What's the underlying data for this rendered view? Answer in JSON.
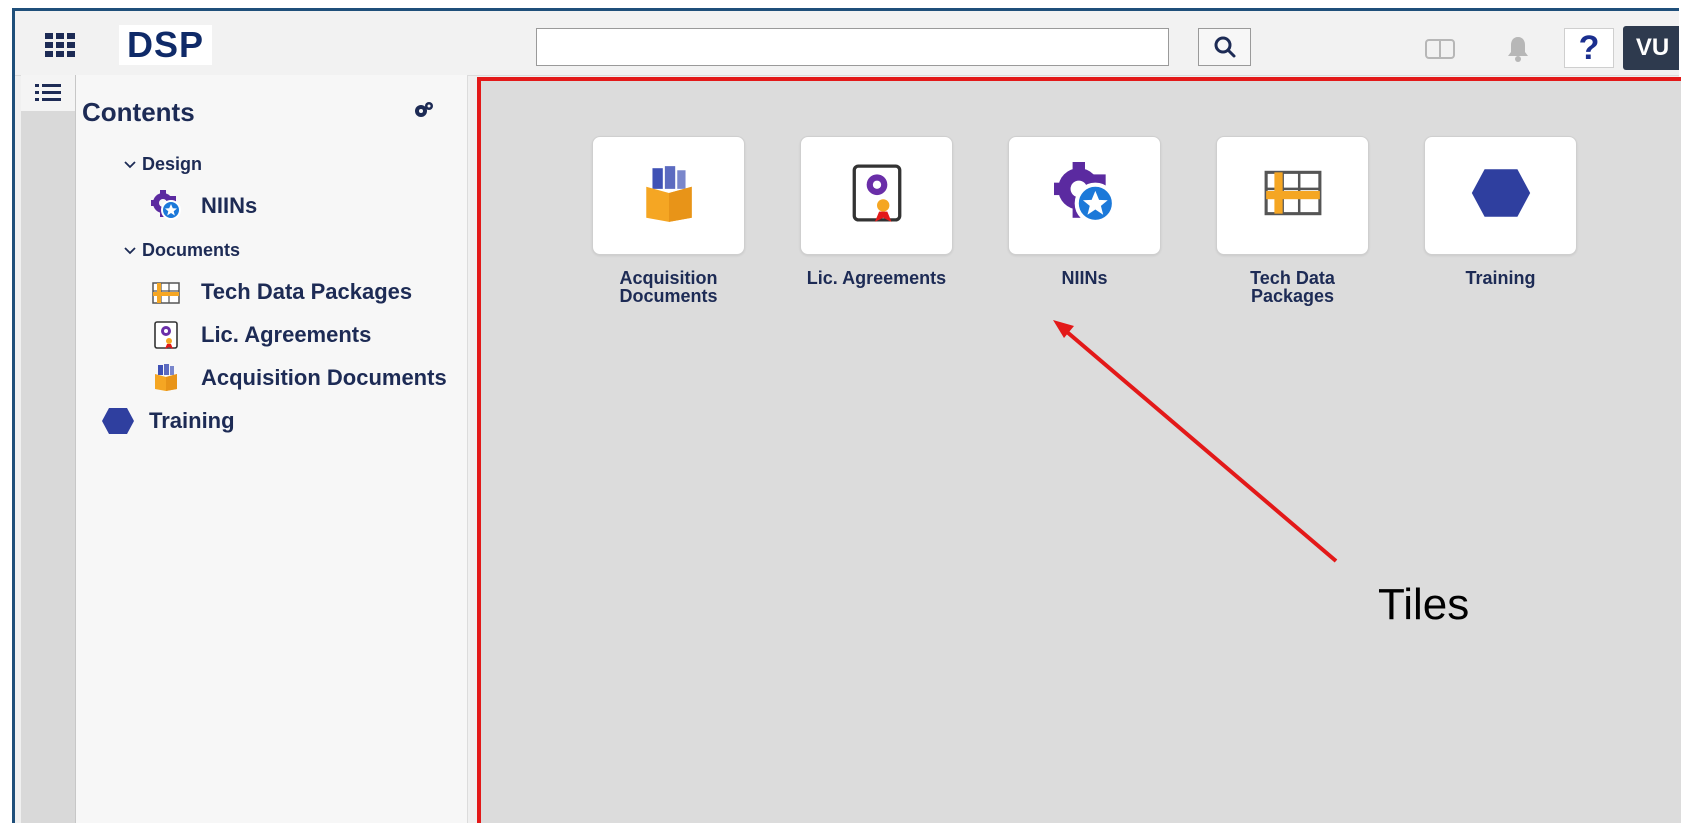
{
  "app": {
    "logo": "DSP",
    "user_initials": "VU",
    "help_label": "?"
  },
  "search": {
    "value": "",
    "placeholder": ""
  },
  "sidebar": {
    "title": "Contents",
    "groups": [
      {
        "label": "Design",
        "items": [
          {
            "label": "NIINs",
            "icon": "gear-star-icon"
          }
        ]
      },
      {
        "label": "Documents",
        "items": [
          {
            "label": "Tech Data Packages",
            "icon": "blueprint-grid-icon"
          },
          {
            "label": "Lic. Agreements",
            "icon": "certificate-icon"
          },
          {
            "label": "Acquisition Documents",
            "icon": "box-icon"
          }
        ]
      }
    ],
    "top_items": [
      {
        "label": "Training",
        "icon": "hexagon-icon"
      }
    ]
  },
  "tiles": [
    {
      "label_line1": "Acquisition",
      "label_line2": "Documents",
      "icon": "box-icon"
    },
    {
      "label_line1": "Lic. Agreements",
      "label_line2": "",
      "icon": "certificate-icon"
    },
    {
      "label_line1": "NIINs",
      "label_line2": "",
      "icon": "gear-star-icon"
    },
    {
      "label_line1": "Tech Data",
      "label_line2": "Packages",
      "icon": "blueprint-grid-icon"
    },
    {
      "label_line1": "Training",
      "label_line2": "",
      "icon": "hexagon-icon"
    }
  ],
  "annotation": {
    "text": "Tiles",
    "color": "#e31919"
  },
  "colors": {
    "accent": "#1d2b55",
    "highlight": "#e31919",
    "orange": "#f5a623",
    "purple": "#5b2aa0",
    "blue_icon": "#1c79d9"
  }
}
